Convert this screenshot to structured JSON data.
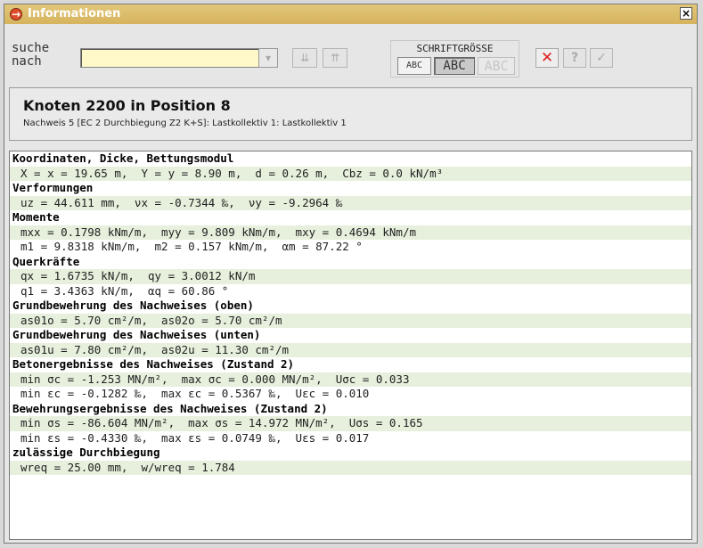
{
  "window": {
    "title": "Informationen",
    "close_symbol": "×"
  },
  "toolbar": {
    "search_label": "suche\nnach",
    "search_value": "",
    "down_symbol": "⇊",
    "up_symbol": "⇈",
    "dropdown_symbol": "▾",
    "fontsize_label": "SCHRIFTGRÖSSE",
    "fontsize_options": [
      "ABC",
      "ABC",
      "ABC"
    ],
    "fontsize_selected": "ABC",
    "cancel_symbol": "✕",
    "help_symbol": "?",
    "ok_symbol": "✓"
  },
  "header": {
    "title": "Knoten 2200 in Position 8",
    "subtitle": "Nachweis 5 [EC 2 Durchbiegung Z2 K+S]: Lastkollektiv 1: Lastkollektiv 1"
  },
  "results": [
    {
      "type": "head",
      "text": "Koordinaten, Dicke, Bettungsmodul"
    },
    {
      "type": "val",
      "text": "X = x = 19.65 m,  Y = y = 8.90 m,  d = 0.26 m,  Cbz = 0.0 kN/m³"
    },
    {
      "type": "head",
      "text": "Verformungen"
    },
    {
      "type": "val",
      "text": "uz = 44.611 mm,  νx = -0.7344 ‰,  νy = -9.2964 ‰"
    },
    {
      "type": "head",
      "text": "Momente"
    },
    {
      "type": "val",
      "text": "mxx = 0.1798 kNm/m,  myy = 9.809 kNm/m,  mxy = 0.4694 kNm/m"
    },
    {
      "type": "val",
      "text": "m1 = 9.8318 kNm/m,  m2 = 0.157 kNm/m,  αm = 87.22 °"
    },
    {
      "type": "head",
      "text": "Querkräfte"
    },
    {
      "type": "val",
      "text": "qx = 1.6735 kN/m,  qy = 3.0012 kN/m"
    },
    {
      "type": "val",
      "text": "q1 = 3.4363 kN/m,  αq = 60.86 °"
    },
    {
      "type": "head",
      "text": "Grundbewehrung des Nachweises (oben)"
    },
    {
      "type": "val",
      "text": "as01o = 5.70 cm²/m,  as02o = 5.70 cm²/m"
    },
    {
      "type": "head",
      "text": "Grundbewehrung des Nachweises (unten)"
    },
    {
      "type": "val",
      "text": "as01u = 7.80 cm²/m,  as02u = 11.30 cm²/m"
    },
    {
      "type": "head",
      "text": "Betonergebnisse des Nachweises (Zustand 2)"
    },
    {
      "type": "val",
      "text": "min σc = -1.253 MN/m²,  max σc = 0.000 MN/m²,  Uσc = 0.033"
    },
    {
      "type": "val",
      "text": "min εc = -0.1282 ‰,  max εc = 0.5367 ‰,  Uεc = 0.010"
    },
    {
      "type": "head",
      "text": "Bewehrungsergebnisse des Nachweises (Zustand 2)"
    },
    {
      "type": "val",
      "text": "min σs = -86.604 MN/m²,  max σs = 14.972 MN/m²,  Uσs = 0.165"
    },
    {
      "type": "val",
      "text": "min εs = -0.4330 ‰,  max εs = 0.0749 ‰,  Uεs = 0.017"
    },
    {
      "type": "head",
      "text": "zulässige Durchbiegung"
    },
    {
      "type": "val",
      "text": "wreq = 25.00 mm,  w/wreq = 1.784"
    }
  ]
}
